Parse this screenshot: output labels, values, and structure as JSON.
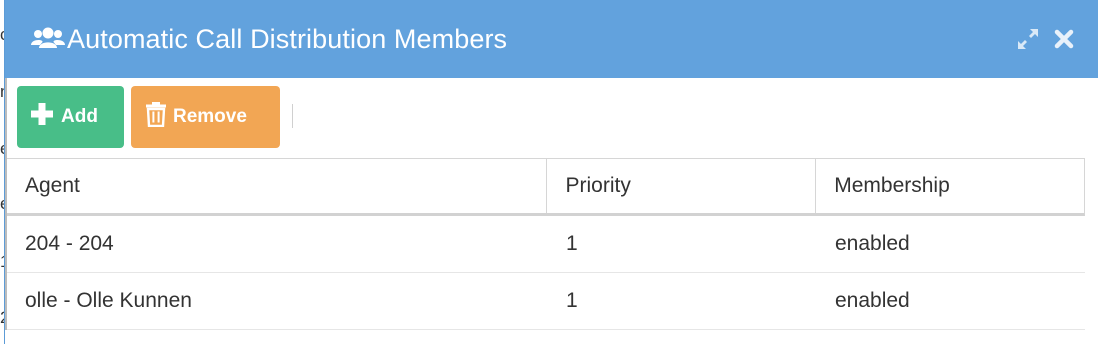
{
  "background": {
    "chars": [
      "c",
      "n",
      "e",
      "e",
      "1",
      "2"
    ]
  },
  "dialog": {
    "title": "Automatic Call Distribution Members",
    "title_icon": "users-icon",
    "maximize_icon": "expand-icon",
    "close_icon": "close-icon",
    "colors": {
      "titlebar": "#62a2dd",
      "add_button": "#48be88",
      "remove_button": "#f2a654"
    }
  },
  "toolbar": {
    "add_label": "Add",
    "remove_label": "Remove"
  },
  "grid": {
    "columns": [
      "Agent",
      "Priority",
      "Membership"
    ],
    "rows": [
      {
        "agent": "204 - 204",
        "priority": "1",
        "membership": "enabled"
      },
      {
        "agent": "olle - Olle Kunnen",
        "priority": "1",
        "membership": "enabled"
      }
    ]
  }
}
